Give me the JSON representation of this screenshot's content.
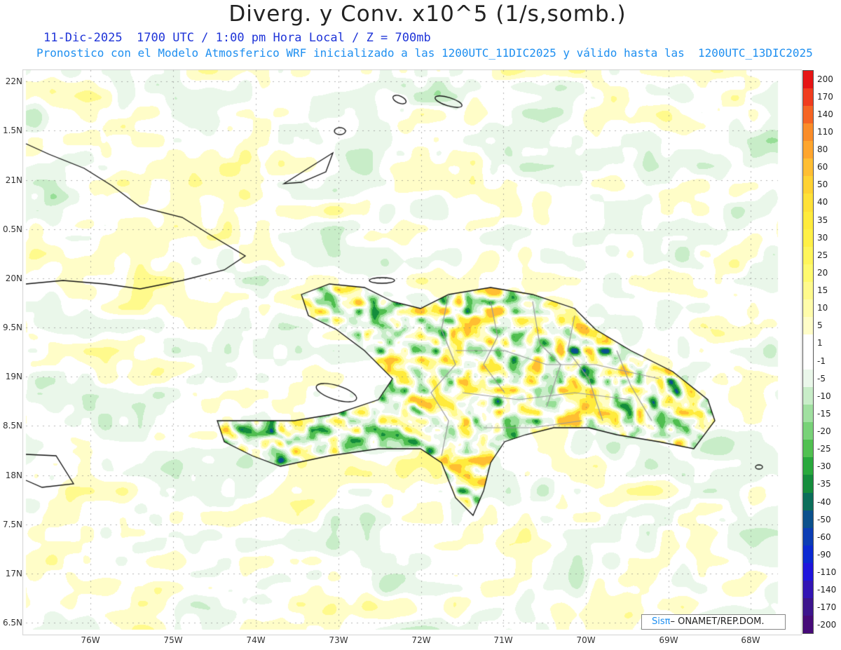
{
  "header": {
    "title": "Diverg. y Conv. x10^5 (1/s,somb.)",
    "subtitle": "11-Dic-2025  1700 UTC / 1:00 pm Hora Local / Z = 700mb",
    "caption": "Pronostico con el Modelo Atmosferico WRF inicializado a las 1200UTC_11DIC2025 y válido hasta las  1200UTC_13DIC2025"
  },
  "axes": {
    "lat_labels": [
      "22N",
      "1.5N",
      "21N",
      "0.5N",
      "20N",
      "9.5N",
      "19N",
      "8.5N",
      "18N",
      "7.5N",
      "17N",
      "6.5N"
    ],
    "lon_labels": [
      "76W",
      "75W",
      "74W",
      "73W",
      "72W",
      "71W",
      "70W",
      "69W",
      "68W"
    ]
  },
  "legend": {
    "levels": [
      "200",
      "170",
      "140",
      "110",
      "80",
      "60",
      "50",
      "40",
      "35",
      "30",
      "25",
      "20",
      "15",
      "10",
      "5",
      "1",
      "-1",
      "-5",
      "-10",
      "-15",
      "-20",
      "-25",
      "-30",
      "-35",
      "-40",
      "-50",
      "-60",
      "-90",
      "-110",
      "-140",
      "-170",
      "-200"
    ],
    "colors": [
      "#e61414",
      "#f03c1e",
      "#f56423",
      "#fa8c28",
      "#ffa52d",
      "#ffbe32",
      "#ffd232",
      "#ffe137",
      "#ffeb3c",
      "#fff046",
      "#fff55a",
      "#fffa6e",
      "#fffa8c",
      "#fffcaa",
      "#fffdc8",
      "#ffffff",
      "#ffffff",
      "#eaf7ea",
      "#c8edc8",
      "#a0e0a0",
      "#78d278",
      "#50c050",
      "#28a83c",
      "#148c3c",
      "#0a6e5a",
      "#0a508c",
      "#0a3cb4",
      "#0a28d2",
      "#1e14dc",
      "#3214b4",
      "#3c148c",
      "#460a78"
    ]
  },
  "credit": {
    "logo": "Sisπ",
    "text": "– ONAMET/REP.DOM."
  }
}
